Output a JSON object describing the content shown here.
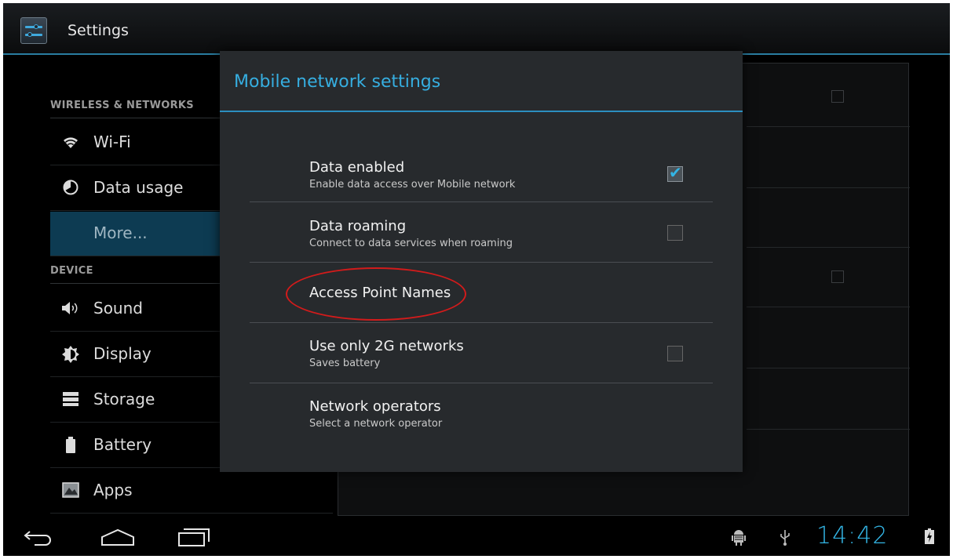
{
  "action_bar": {
    "app_title": "Settings",
    "app_icon": "settings-sliders-icon"
  },
  "sidebar": {
    "section_wireless": "WIRELESS & NETWORKS",
    "section_device": "DEVICE",
    "items": [
      {
        "label": "Wi-Fi",
        "icon": "wifi-icon"
      },
      {
        "label": "Data usage",
        "icon": "data-usage-icon"
      },
      {
        "label": "More...",
        "icon": "",
        "selected": true
      },
      {
        "label": "Sound",
        "icon": "speaker-icon"
      },
      {
        "label": "Display",
        "icon": "brightness-icon"
      },
      {
        "label": "Storage",
        "icon": "storage-icon"
      },
      {
        "label": "Battery",
        "icon": "battery-icon"
      },
      {
        "label": "Apps",
        "icon": "apps-icon"
      }
    ]
  },
  "dialog": {
    "title": "Mobile network settings",
    "preferences": [
      {
        "title": "Data enabled",
        "summary": "Enable data access over Mobile network",
        "checked": true
      },
      {
        "title": "Data roaming",
        "summary": "Connect to data services when roaming",
        "checked": false
      },
      {
        "title": "Access Point Names",
        "summary": "",
        "highlighted": true
      },
      {
        "title": "Use only 2G networks",
        "summary": "Saves battery",
        "checked": false
      },
      {
        "title": "Network operators",
        "summary": "Select a network operator"
      }
    ]
  },
  "system_bar": {
    "clock": "14:42",
    "buttons": [
      "back-icon",
      "home-icon",
      "recent-apps-icon"
    ],
    "status_icons": [
      "android-debug-icon",
      "usb-icon",
      "battery-charging-icon"
    ]
  },
  "colors": {
    "accent": "#33b5e5",
    "selected_bg": "#0d3b52",
    "highlight": "#d21b1b"
  }
}
